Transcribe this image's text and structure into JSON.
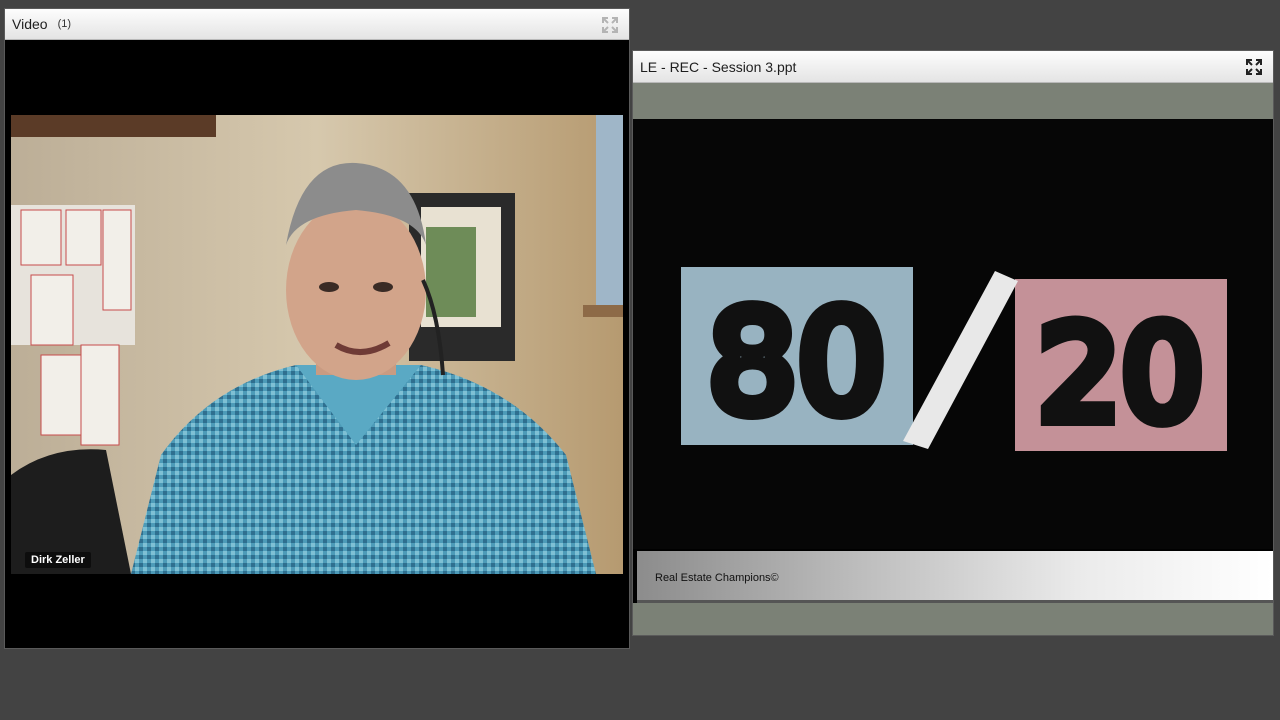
{
  "video_pod": {
    "title": "Video",
    "count": "(1)",
    "participant_name": "Dirk Zeller",
    "fullscreen_icon": "expand-arrows-icon"
  },
  "share_pod": {
    "title": "LE - REC - Session 3.ppt",
    "fullscreen_icon": "expand-arrows-icon",
    "slide": {
      "left_number": "80",
      "right_number": "20",
      "footer_text": "Real Estate Champions©"
    }
  },
  "colors": {
    "background": "#434343",
    "header": "#e9e9e9",
    "share_bg": "#7b8176",
    "chalk_blue": "#a9c6d6",
    "chalk_pink": "#d9a1a8"
  }
}
